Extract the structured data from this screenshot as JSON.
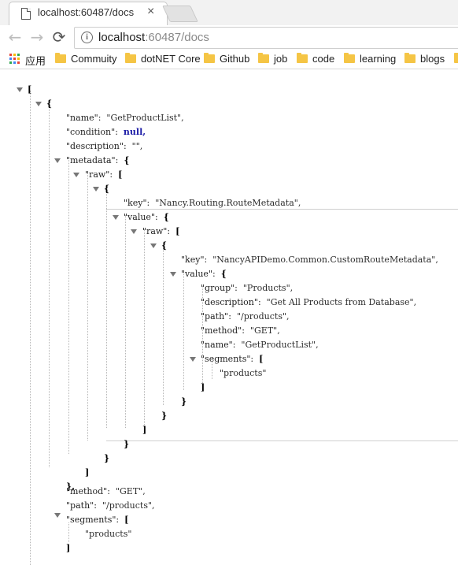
{
  "tab": {
    "title": "localhost:60487/docs",
    "close": "×"
  },
  "nav": {
    "back": "←",
    "forward": "→",
    "reload": "⟳"
  },
  "address": {
    "host": "localhost",
    "rest": ":60487/docs",
    "info": "i"
  },
  "bookmarks": [
    {
      "label": "应用",
      "icon": "apps-grid-icon"
    },
    {
      "label": "Commuity",
      "icon": "folder-icon"
    },
    {
      "label": "dotNET Core",
      "icon": "folder-icon"
    },
    {
      "label": "Github",
      "icon": "folder-icon"
    },
    {
      "label": "job",
      "icon": "folder-icon"
    },
    {
      "label": "code",
      "icon": "folder-icon"
    },
    {
      "label": "learning",
      "icon": "folder-icon"
    },
    {
      "label": "blogs",
      "icon": "folder-icon"
    }
  ],
  "json": {
    "open_bracket": "[",
    "open_brace": "{",
    "close_bracket": "]",
    "close_brace": "}",
    "close_brace_comma": "},",
    "close_bracket_comma": "],",
    "name_key": "\"name\": ",
    "name_val": "\"GetProductList\",",
    "condition_key": "\"condition\": ",
    "condition_val": "null,",
    "description_key": "\"description\": ",
    "description_val": "\"\",",
    "metadata_key": "\"metadata\": ",
    "raw_key": "\"raw\": ",
    "key_key": "\"key\": ",
    "key_val_1": "\"Nancy.Routing.RouteMetadata\",",
    "value_key": "\"value\": ",
    "key_val_2": "\"NancyAPIDemo.Common.CustomRouteMetadata\",",
    "group_key": "\"group\": ",
    "group_val": "\"Products\",",
    "desc_val_2": "\"Get All Products from Database\",",
    "path_key": "\"path\": ",
    "path_val": "\"/products\",",
    "method_key": "\"method\": ",
    "method_val": "\"GET\",",
    "segments_key": "\"segments\": ",
    "segment_item": "\"products\""
  }
}
